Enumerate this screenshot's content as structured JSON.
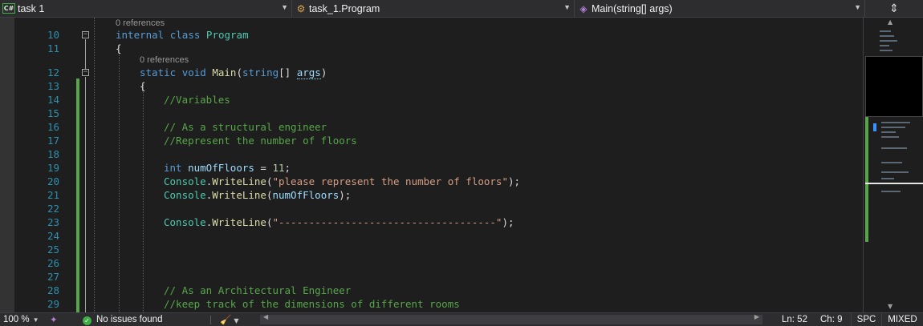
{
  "navbar": {
    "project": "task 1",
    "project_icon": "C#",
    "class": "task_1.Program",
    "member": "Main(string[] args)",
    "split_icon": "split-editor-icon"
  },
  "editor": {
    "references_1": "0 references",
    "references_2": "0 references",
    "line_numbers": [
      "10",
      "11",
      "12",
      "13",
      "14",
      "15",
      "16",
      "17",
      "18",
      "19",
      "20",
      "21",
      "22",
      "23",
      "24",
      "25",
      "26",
      "27",
      "28",
      "29"
    ],
    "fold_symbol": "−",
    "lines": {
      "l10": {
        "kw1": "internal",
        "kw2": "class",
        "name": "Program"
      },
      "l11": {
        "brace": "{"
      },
      "l12": {
        "kw1": "static",
        "kw2": "void",
        "name": "Main",
        "open": "(",
        "ptype": "string",
        "arr": "[] ",
        "param": "args",
        "close": ")"
      },
      "l13": {
        "brace": "{"
      },
      "l14": {
        "comment": "//Variables"
      },
      "l16": {
        "comment": "// As a structural engineer"
      },
      "l17": {
        "comment": "//Represent the number of floors"
      },
      "l19": {
        "kw": "int",
        "var": "numOfFloors",
        "op": " = ",
        "num": "11",
        "end": ";"
      },
      "l20": {
        "cls": "Console",
        "dot": ".",
        "fn": "WriteLine",
        "open": "(",
        "str": "\"please represent the number of floors\"",
        "end": ");"
      },
      "l21": {
        "cls": "Console",
        "dot": ".",
        "fn": "WriteLine",
        "open": "(",
        "arg": "numOfFloors",
        "end": ");"
      },
      "l23": {
        "cls": "Console",
        "dot": ".",
        "fn": "WriteLine",
        "open": "(",
        "str": "\"------------------------------------\"",
        "end": ");"
      },
      "l28": {
        "comment": "// As an Architectural Engineer"
      },
      "l29": {
        "comment": "//keep track of the dimensions of different rooms"
      }
    }
  },
  "status": {
    "zoom": "100 %",
    "issues": "No issues found",
    "ln": "Ln: 52",
    "ch": "Ch: 9",
    "spc": "SPC",
    "eol": "MIXED"
  },
  "colors": {
    "keyword": "#569cd6",
    "type": "#4ec9b0",
    "method": "#dcdcaa",
    "identifier": "#9cdcfe",
    "string": "#d69d85",
    "comment": "#57a64a",
    "number": "#b5cea8",
    "line_number": "#2b91af",
    "change_bar": "#57a64a"
  }
}
